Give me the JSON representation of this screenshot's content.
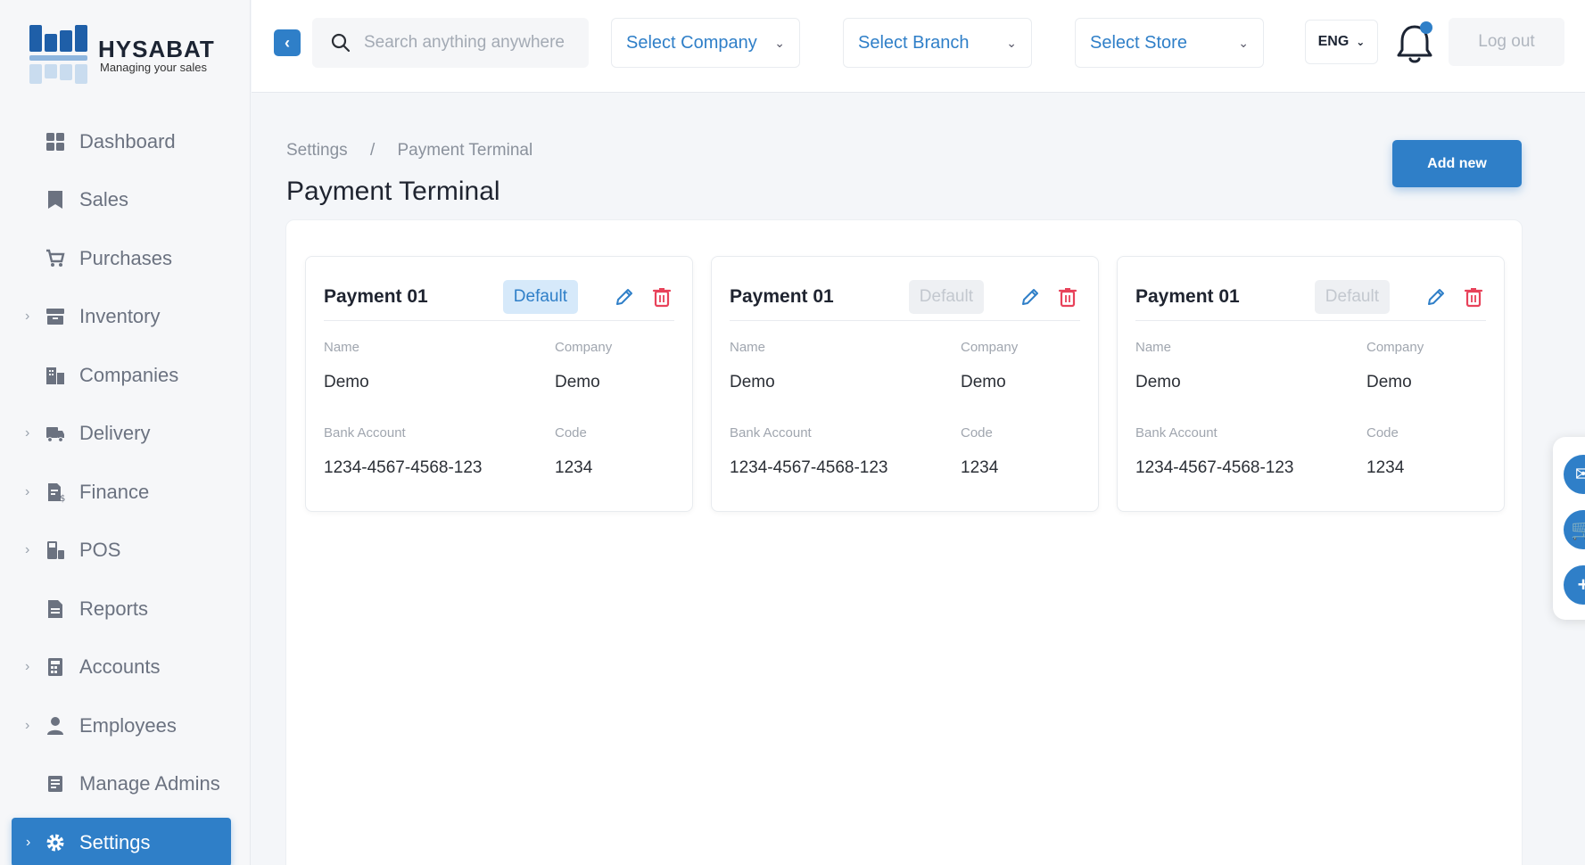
{
  "brand": {
    "name": "HYSABAT",
    "tagline": "Managing your sales"
  },
  "sidebar": {
    "items": [
      {
        "label": "Dashboard",
        "icon": "dashboard-icon",
        "expandable": false
      },
      {
        "label": "Sales",
        "icon": "sales-icon",
        "expandable": false
      },
      {
        "label": "Purchases",
        "icon": "cart-icon",
        "expandable": false
      },
      {
        "label": "Inventory",
        "icon": "inventory-icon",
        "expandable": true
      },
      {
        "label": "Companies",
        "icon": "building-icon",
        "expandable": false
      },
      {
        "label": "Delivery",
        "icon": "truck-icon",
        "expandable": true
      },
      {
        "label": "Finance",
        "icon": "finance-icon",
        "expandable": true
      },
      {
        "label": "POS",
        "icon": "pos-icon",
        "expandable": true
      },
      {
        "label": "Reports",
        "icon": "report-icon",
        "expandable": false
      },
      {
        "label": "Accounts",
        "icon": "calculator-icon",
        "expandable": true
      },
      {
        "label": "Employees",
        "icon": "user-icon",
        "expandable": true
      },
      {
        "label": "Manage Admins",
        "icon": "admin-icon",
        "expandable": false
      },
      {
        "label": "Settings",
        "icon": "gear-icon",
        "expandable": true,
        "active": true
      }
    ]
  },
  "topbar": {
    "search_placeholder": "Search anything anywhere",
    "company_select": "Select Company",
    "branch_select": "Select Branch",
    "store_select": "Select Store",
    "language": "ENG",
    "logout": "Log out"
  },
  "breadcrumb": {
    "parent": "Settings",
    "separator": "/",
    "current": "Payment Terminal"
  },
  "page": {
    "title": "Payment Terminal",
    "add_button": "Add new"
  },
  "labels": {
    "name": "Name",
    "company": "Company",
    "bank_account": "Bank Account",
    "code": "Code"
  },
  "cards": [
    {
      "title": "Payment 01",
      "badge": "Default",
      "is_default": true,
      "name": "Demo",
      "company": "Demo",
      "bank_account": "1234-4567-4568-123",
      "code": "1234"
    },
    {
      "title": "Payment 01",
      "badge": "Default",
      "is_default": false,
      "name": "Demo",
      "company": "Demo",
      "bank_account": "1234-4567-4568-123",
      "code": "1234"
    },
    {
      "title": "Payment 01",
      "badge": "Default",
      "is_default": false,
      "name": "Demo",
      "company": "Demo",
      "bank_account": "1234-4567-4568-123",
      "code": "1234"
    }
  ],
  "colors": {
    "accent": "#2f7fc8",
    "danger": "#e8425a",
    "notification": "#2f7fc8"
  }
}
